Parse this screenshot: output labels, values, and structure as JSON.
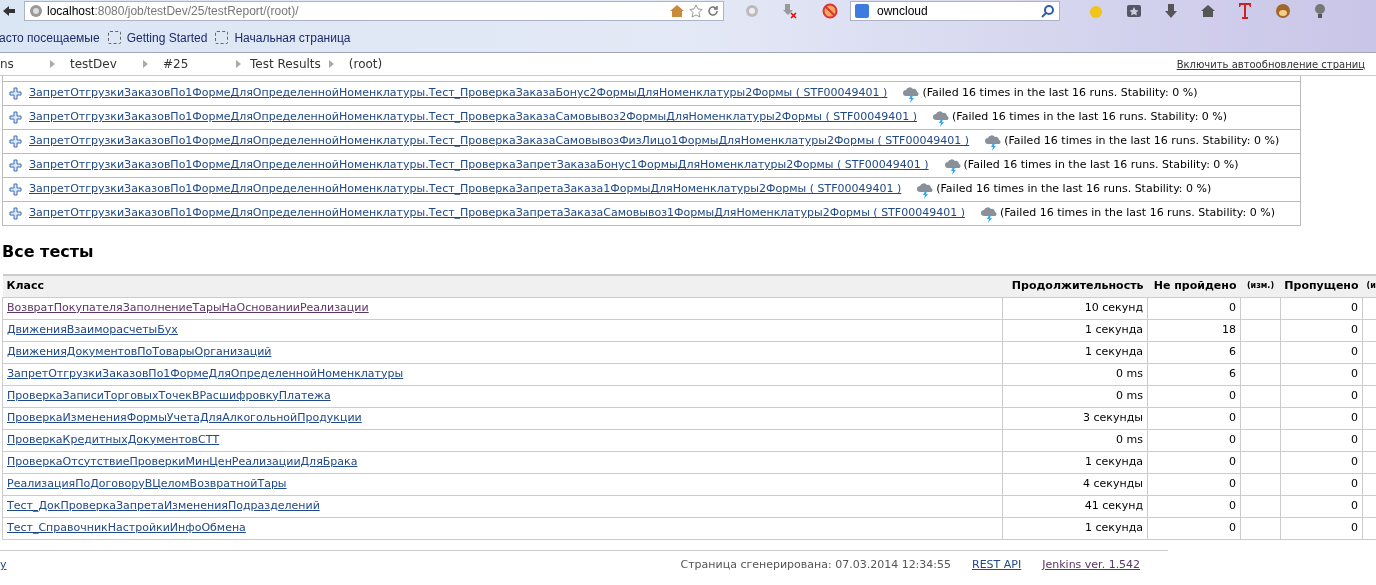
{
  "browser": {
    "url_host": "localhost",
    "url_rest": ":8080/job/testDev/25/testReport/(root)/",
    "search_value": "owncloud",
    "bookmarks": [
      "асто посещаемые",
      "Getting Started",
      "Начальная страница"
    ]
  },
  "breadcrumbs": [
    "ns",
    "testDev",
    "#25",
    "Test Results",
    "(root)"
  ],
  "auto_refresh_link": "Включить автообновление страниц",
  "failed_tests": [
    {
      "name": "ЗапретОтгрузкиЗаказовПо1ФормеДляОпределеннойНоменклатуры.Тест_ПроверкаЗаказаБонус2ФормыДляНоменклатуры2Формы ( STF00049401 )",
      "stability": "(Failed 16 times in the last 16 runs. Stability: 0 %)"
    },
    {
      "name": "ЗапретОтгрузкиЗаказовПо1ФормеДляОпределеннойНоменклатуры.Тест_ПроверкаЗаказаСамовывоз2ФормыДляНоменклатуры2Формы ( STF00049401 )",
      "stability": "(Failed 16 times in the last 16 runs. Stability: 0 %)"
    },
    {
      "name": "ЗапретОтгрузкиЗаказовПо1ФормеДляОпределеннойНоменклатуры.Тест_ПроверкаЗаказаСамовывозФизЛицо1ФормыДляНоменклатуры2Формы ( STF00049401 )",
      "stability": "(Failed 16 times in the last 16 runs. Stability: 0 %)"
    },
    {
      "name": "ЗапретОтгрузкиЗаказовПо1ФормеДляОпределеннойНоменклатуры.Тест_ПроверкаЗапретЗаказаБонус1ФормыДляНоменклатуры2Формы ( STF00049401 )",
      "stability": "(Failed 16 times in the last 16 runs. Stability: 0 %)"
    },
    {
      "name": "ЗапретОтгрузкиЗаказовПо1ФормеДляОпределеннойНоменклатуры.Тест_ПроверкаЗапретаЗаказа1ФормыДляНоменклатуры2Формы ( STF00049401 )",
      "stability": "(Failed 16 times in the last 16 runs. Stability: 0 %)"
    },
    {
      "name": "ЗапретОтгрузкиЗаказовПо1ФормеДляОпределеннойНоменклатуры.Тест_ПроверкаЗапретаЗаказаСамовывоз1ФормыДляНоменклатуры2Формы ( STF00049401 )",
      "stability": "(Failed 16 times in the last 16 runs. Stability: 0 %)"
    }
  ],
  "all_tests": {
    "title": "Все тесты",
    "columns": [
      "Класс",
      "Продолжительность",
      "Не пройдено",
      "(изм.)",
      "Пропущено",
      "(и"
    ],
    "rows": [
      {
        "class": "ВозвратПокупателяЗаполнениеТарыНаОснованииРеализации",
        "visited": true,
        "duration": "10 секунд",
        "failed": "0",
        "skipped": "0"
      },
      {
        "class": "ДвиженияВзаиморасчетыБух",
        "visited": false,
        "duration": "1 секунда",
        "failed": "18",
        "skipped": "0"
      },
      {
        "class": "ДвиженияДокументовПоТоварыОрганизаций",
        "visited": false,
        "duration": "1 секунда",
        "failed": "6",
        "skipped": "0"
      },
      {
        "class": "ЗапретОтгрузкиЗаказовПо1ФормеДляОпределеннойНоменклатуры",
        "visited": false,
        "duration": "0 ms",
        "failed": "6",
        "skipped": "0"
      },
      {
        "class": "ПроверкаЗаписиТорговыхТочекВРасшифровкуПлатежа",
        "visited": false,
        "duration": "0 ms",
        "failed": "0",
        "skipped": "0"
      },
      {
        "class": "ПроверкаИзмененияФормыУчетаДляАлкогольнойПродукции",
        "visited": false,
        "duration": "3 секунды",
        "failed": "0",
        "skipped": "0"
      },
      {
        "class": "ПроверкаКредитныхДокументовСТТ",
        "visited": false,
        "duration": "0 ms",
        "failed": "0",
        "skipped": "0"
      },
      {
        "class": "ПроверкаОтсутствиеПроверкиМинЦенРеализацииДляБрака",
        "visited": false,
        "duration": "1 секунда",
        "failed": "0",
        "skipped": "0"
      },
      {
        "class": "РеализацияПоДоговоруВЦеломВозвратнойТары",
        "visited": false,
        "duration": "4 секунды",
        "failed": "0",
        "skipped": "0"
      },
      {
        "class": "Тест_ДокПроверкаЗапретаИзмененияПодразделений",
        "visited": false,
        "duration": "41 секунд",
        "failed": "0",
        "skipped": "0"
      },
      {
        "class": "Тест_СправочникНастройкиИнфоОбмена",
        "visited": false,
        "duration": "1 секунда",
        "failed": "0",
        "skipped": "0"
      }
    ]
  },
  "footer": {
    "left_link": "y",
    "generated": "Страница сгенерирована: 07.03.2014 12:34:55",
    "links": [
      {
        "text": "REST API",
        "visited": false
      },
      {
        "text": "Jenkins ver. 1.542",
        "visited": true
      }
    ]
  }
}
